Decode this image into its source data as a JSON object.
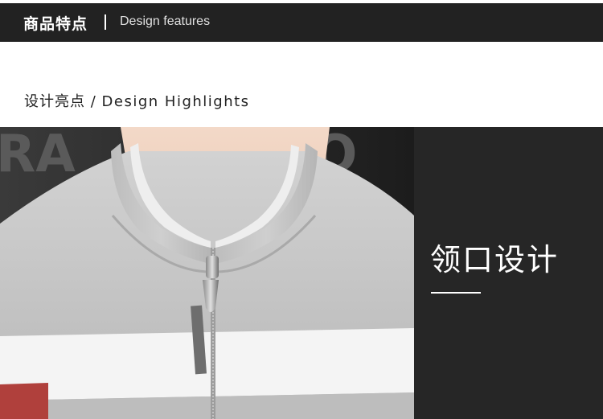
{
  "header": {
    "title_zh": "商品特点",
    "title_en": "Design features"
  },
  "section": {
    "title_zh": "设计亮点",
    "separator": "/",
    "title_en": "Design Highlights"
  },
  "feature": {
    "label": "领口设计"
  },
  "photo": {
    "subject": "stand-collar zip jacket close-up"
  },
  "colors": {
    "dark_bar": "#222222",
    "panel": "#262626",
    "jacket_gray": "#c8c8c8",
    "jacket_white": "#f2f2f2"
  }
}
